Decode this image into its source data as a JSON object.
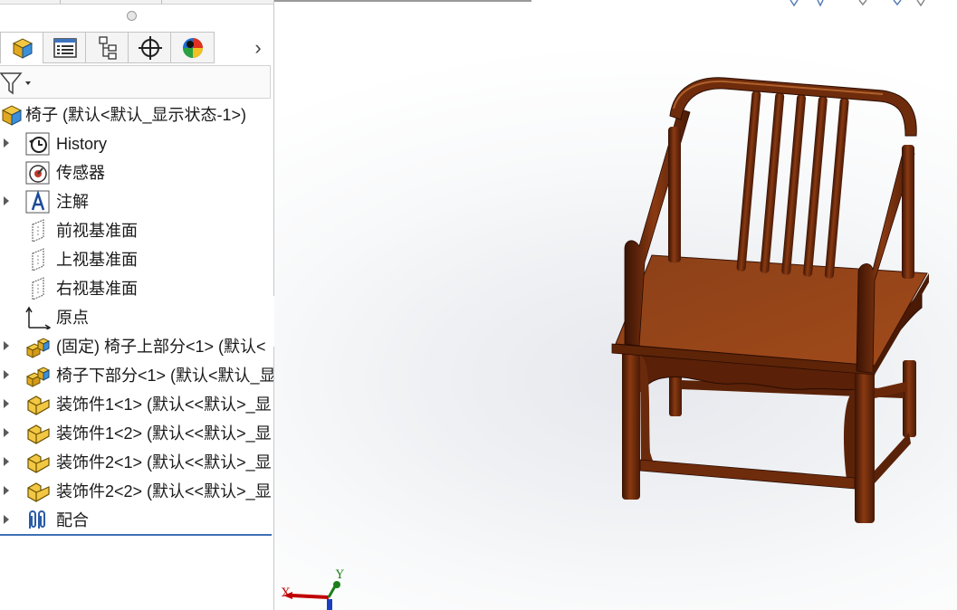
{
  "feature_tree": {
    "root": {
      "label": "椅子 (默认<默认_显示状态-1>)",
      "icon": "assembly-icon"
    },
    "items": [
      {
        "label": "History",
        "icon": "history-icon",
        "expandable": true
      },
      {
        "label": "传感器",
        "icon": "sensor-icon",
        "expandable": false
      },
      {
        "label": "注解",
        "icon": "annotation-icon",
        "expandable": true
      },
      {
        "label": "前视基准面",
        "icon": "plane-icon",
        "expandable": false
      },
      {
        "label": "上视基准面",
        "icon": "plane-icon",
        "expandable": false
      },
      {
        "label": "右视基准面",
        "icon": "plane-icon",
        "expandable": false
      },
      {
        "label": "原点",
        "icon": "origin-icon",
        "expandable": false
      },
      {
        "label": "(固定) 椅子上部分<1> (默认<",
        "icon": "subassembly-icon",
        "expandable": true
      },
      {
        "label": "椅子下部分<1> (默认<默认_显",
        "icon": "subassembly-icon",
        "expandable": true
      },
      {
        "label": "装饰件1<1> (默认<<默认>_显",
        "icon": "part-icon",
        "expandable": true
      },
      {
        "label": "装饰件1<2> (默认<<默认>_显",
        "icon": "part-icon",
        "expandable": true
      },
      {
        "label": "装饰件2<1> (默认<<默认>_显",
        "icon": "part-icon",
        "expandable": true
      },
      {
        "label": "装饰件2<2> (默认<<默认>_显",
        "icon": "part-icon",
        "expandable": true
      },
      {
        "label": "配合",
        "icon": "mates-icon",
        "expandable": true
      }
    ]
  },
  "tabs": [
    {
      "name": "feature-manager-tab",
      "icon": "feature-manager-icon",
      "active": true
    },
    {
      "name": "property-manager-tab",
      "icon": "property-manager-icon",
      "active": false
    },
    {
      "name": "configuration-manager-tab",
      "icon": "configuration-manager-icon",
      "active": false
    },
    {
      "name": "dimxpert-tab",
      "icon": "crosshair-icon",
      "active": false
    },
    {
      "name": "display-manager-tab",
      "icon": "appearance-icon",
      "active": false
    }
  ],
  "triad": {
    "x_label": "X",
    "y_label": "Y"
  },
  "colors": {
    "wood_dark": "#4a1c05",
    "wood_mid": "#7a3410",
    "wood_light": "#a04a18",
    "tree_selection_line": "#3e6fb5"
  }
}
